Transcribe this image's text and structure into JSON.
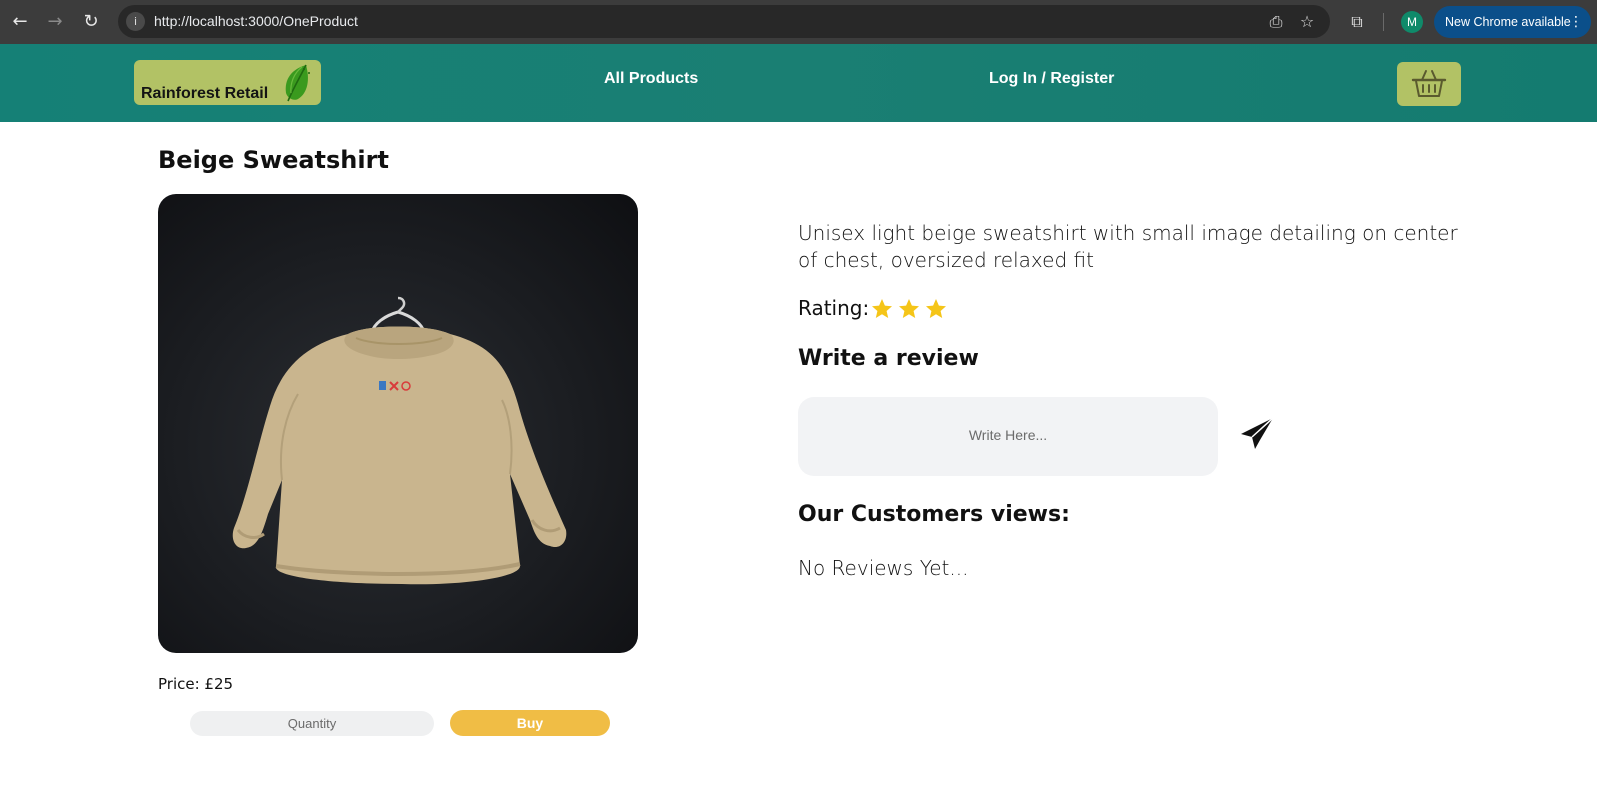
{
  "browser": {
    "url": "http://localhost:3000/OneProduct",
    "update_label": "New Chrome available",
    "profile_initial": "M",
    "icons": [
      "back-arrow-icon",
      "forward-arrow-icon",
      "reload-icon",
      "site-info-icon",
      "install-app-icon",
      "bookmark-star-icon",
      "extensions-icon",
      "menu-dots-icon"
    ]
  },
  "header": {
    "logo_text": "Rainforest Retail",
    "nav": {
      "all_products": "All Products",
      "login": "Log In / Register"
    },
    "colors": {
      "bar": "#1a7f73",
      "logo_bg": "#b2c265",
      "cart_bg": "#b2c265"
    }
  },
  "product": {
    "title": "Beige Sweatshirt",
    "description": "Unisex light beige sweatshirt with small image detailing on center of chest, oversized relaxed fit",
    "rating_label": "Rating:",
    "rating_value": 3,
    "price": "Price: £25",
    "quantity_placeholder": "Quantity",
    "buy_label": "Buy",
    "buy_color": "#f0bd45"
  },
  "reviews": {
    "write_heading": "Write a review",
    "input_placeholder": "Write Here...",
    "customers_heading": "Our Customers views:",
    "empty_text": "No Reviews Yet..."
  }
}
